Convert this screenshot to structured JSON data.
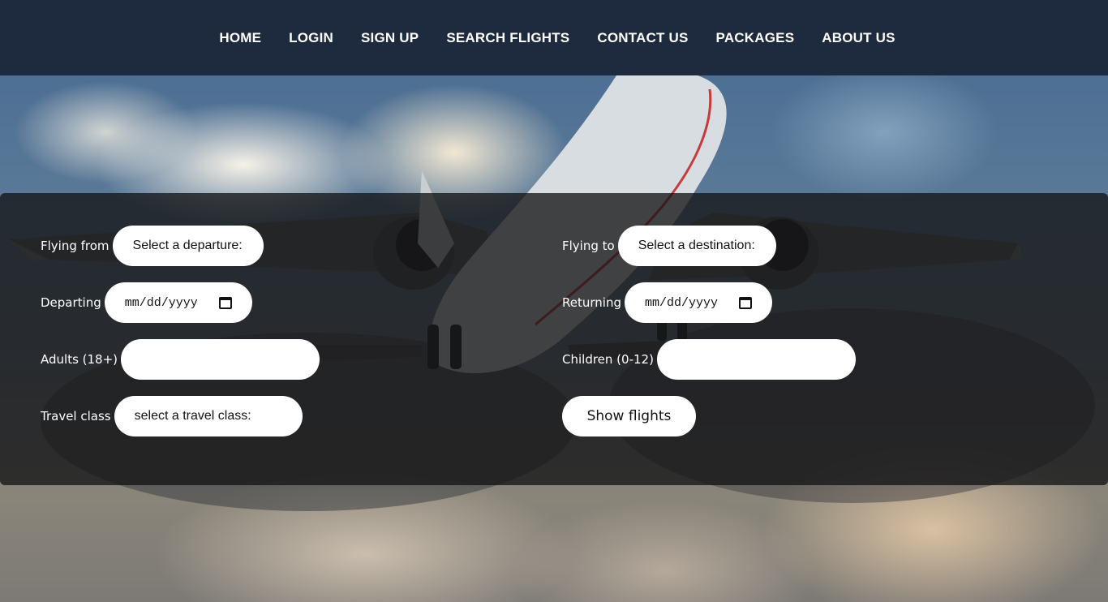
{
  "nav": {
    "items": [
      {
        "label": "HOME"
      },
      {
        "label": "LOGIN"
      },
      {
        "label": "SIGN UP"
      },
      {
        "label": "SEARCH FLIGHTS"
      },
      {
        "label": "CONTACT US"
      },
      {
        "label": "PACKAGES"
      },
      {
        "label": "ABOUT US"
      }
    ]
  },
  "form": {
    "from": {
      "label": "Flying from",
      "value": "Select a departure:"
    },
    "to": {
      "label": "Flying to",
      "value": "Select a destination:"
    },
    "departing": {
      "label": "Departing",
      "placeholder": "mm/dd/yyyy"
    },
    "returning": {
      "label": "Returning",
      "placeholder": "mm/dd/yyyy"
    },
    "adults": {
      "label": "Adults (18+)",
      "value": ""
    },
    "children": {
      "label": "Children (0-12)",
      "value": ""
    },
    "travel_class": {
      "label": "Travel class",
      "value": "select a travel class:"
    },
    "submit_label": "Show flights"
  },
  "colors": {
    "navbar_bg": "#1e2a3d",
    "panel_bg": "rgba(20,20,22,0.78)",
    "control_bg": "#ffffff"
  }
}
